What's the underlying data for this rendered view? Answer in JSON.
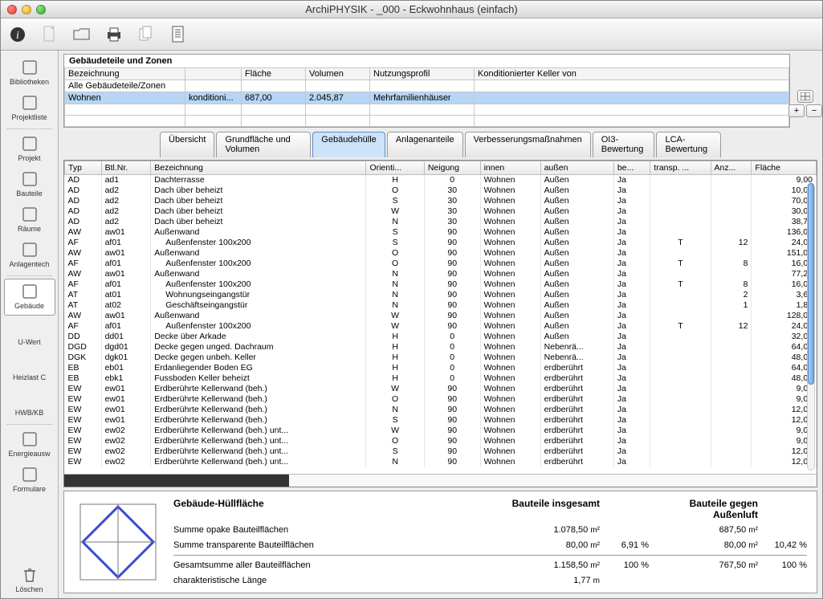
{
  "window_title": "ArchiPHYSIK - _000 - Eckwohnhaus (einfach)",
  "sidebar": [
    {
      "label": "Bibliotheken",
      "icon": "books"
    },
    {
      "label": "Projektliste",
      "icon": "list"
    },
    {
      "label": "Projekt",
      "icon": "house"
    },
    {
      "label": "Bauteile",
      "icon": "wall"
    },
    {
      "label": "Räume",
      "icon": "cube"
    },
    {
      "label": "Anlagentech",
      "icon": "gear"
    },
    {
      "label": "Gebäude",
      "icon": "building",
      "selected": true
    },
    {
      "label": "U-Wert",
      "icon": ""
    },
    {
      "label": "Heizlast C",
      "icon": ""
    },
    {
      "label": "HWB/KB",
      "icon": ""
    },
    {
      "label": "Energieausw",
      "icon": "chart"
    },
    {
      "label": "Formulare",
      "icon": "forms"
    },
    {
      "label": "Löschen",
      "icon": "trash",
      "bottom": true
    }
  ],
  "zones": {
    "title": "Gebäudeteile und Zonen",
    "headers": [
      "Bezeichnung",
      "",
      "Fläche",
      "Volumen",
      "Nutzungsprofil",
      "Konditionierter Keller von"
    ],
    "rows": [
      {
        "c": [
          "Alle Gebäudeteile/Zonen",
          "",
          "",
          "",
          "",
          ""
        ]
      },
      {
        "c": [
          "Wohnen",
          "konditioni...",
          "687,00",
          "2.045,87",
          "Mehrfamilienhäuser",
          ""
        ],
        "sel": true
      },
      {
        "c": [
          "",
          "",
          "",
          "",
          "",
          ""
        ]
      },
      {
        "c": [
          "",
          "",
          "",
          "",
          "",
          ""
        ]
      }
    ]
  },
  "tabs": [
    "Übersicht",
    "Grundfläche und Volumen",
    "Gebäudehülle",
    "Anlagenanteile",
    "Verbesserungsmaßnahmen",
    "OI3-Bewertung",
    "LCA-Bewertung"
  ],
  "active_tab": 2,
  "grid": {
    "headers": [
      "Typ",
      "Btl.Nr.",
      "Bezeichnung",
      "Orienti...",
      "Neigung",
      "innen",
      "außen",
      "be...",
      "transp. ...",
      "Anz...",
      "Fläche"
    ],
    "rows": [
      [
        "AD",
        "ad1",
        "Dachterrasse",
        "H",
        "0",
        "Wohnen",
        "Außen",
        "Ja",
        "",
        "",
        "9,00"
      ],
      [
        "AD",
        "ad2",
        "Dach über beheizt",
        "O",
        "30",
        "Wohnen",
        "Außen",
        "Ja",
        "",
        "",
        "10,00"
      ],
      [
        "AD",
        "ad2",
        "Dach über beheizt",
        "S",
        "30",
        "Wohnen",
        "Außen",
        "Ja",
        "",
        "",
        "70,00"
      ],
      [
        "AD",
        "ad2",
        "Dach über beheizt",
        "W",
        "30",
        "Wohnen",
        "Außen",
        "Ja",
        "",
        "",
        "30,00"
      ],
      [
        "AD",
        "ad2",
        "Dach über beheizt",
        "N",
        "30",
        "Wohnen",
        "Außen",
        "Ja",
        "",
        "",
        "38,75"
      ],
      [
        "AW",
        "aw01",
        "Außenwand",
        "S",
        "90",
        "Wohnen",
        "Außen",
        "Ja",
        "",
        "",
        "136,00"
      ],
      [
        "AF",
        "af01",
        "   Außenfenster 100x200",
        "S",
        "90",
        "Wohnen",
        "Außen",
        "Ja",
        "T",
        "12",
        "24,00"
      ],
      [
        "AW",
        "aw01",
        "Außenwand",
        "O",
        "90",
        "Wohnen",
        "Außen",
        "Ja",
        "",
        "",
        "151,00"
      ],
      [
        "AF",
        "af01",
        "   Außenfenster 100x200",
        "O",
        "90",
        "Wohnen",
        "Außen",
        "Ja",
        "T",
        "8",
        "16,00"
      ],
      [
        "AW",
        "aw01",
        "Außenwand",
        "N",
        "90",
        "Wohnen",
        "Außen",
        "Ja",
        "",
        "",
        "77,29"
      ],
      [
        "AF",
        "af01",
        "   Außenfenster 100x200",
        "N",
        "90",
        "Wohnen",
        "Außen",
        "Ja",
        "T",
        "8",
        "16,00"
      ],
      [
        "AT",
        "at01",
        "   Wohnungseingangstür",
        "N",
        "90",
        "Wohnen",
        "Außen",
        "Ja",
        "",
        "2",
        "3,64"
      ],
      [
        "AT",
        "at02",
        "   Geschäftseingangstür",
        "N",
        "90",
        "Wohnen",
        "Außen",
        "Ja",
        "",
        "1",
        "1,82"
      ],
      [
        "AW",
        "aw01",
        "Außenwand",
        "W",
        "90",
        "Wohnen",
        "Außen",
        "Ja",
        "",
        "",
        "128,00"
      ],
      [
        "AF",
        "af01",
        "   Außenfenster 100x200",
        "W",
        "90",
        "Wohnen",
        "Außen",
        "Ja",
        "T",
        "12",
        "24,00"
      ],
      [
        "DD",
        "dd01",
        "Decke über Arkade",
        "H",
        "0",
        "Wohnen",
        "Außen",
        "Ja",
        "",
        "",
        "32,00"
      ],
      [
        "DGD",
        "dgd01",
        "Decke gegen unged. Dachraum",
        "H",
        "0",
        "Wohnen",
        "Nebenrä...",
        "Ja",
        "",
        "",
        "64,00"
      ],
      [
        "DGK",
        "dgk01",
        "Decke gegen unbeh. Keller",
        "H",
        "0",
        "Wohnen",
        "Nebenrä...",
        "Ja",
        "",
        "",
        "48,00"
      ],
      [
        "EB",
        "eb01",
        "Erdanliegender Boden EG",
        "H",
        "0",
        "Wohnen",
        "erdberührt",
        "Ja",
        "",
        "",
        "64,00"
      ],
      [
        "EB",
        "ebk1",
        "Fussboden Keller beheizt",
        "H",
        "0",
        "Wohnen",
        "erdberührt",
        "Ja",
        "",
        "",
        "48,00"
      ],
      [
        "EW",
        "ew01",
        "Erdberührte Kellerwand (beh.)",
        "W",
        "90",
        "Wohnen",
        "erdberührt",
        "Ja",
        "",
        "",
        "9,00"
      ],
      [
        "EW",
        "ew01",
        "Erdberührte Kellerwand (beh.)",
        "O",
        "90",
        "Wohnen",
        "erdberührt",
        "Ja",
        "",
        "",
        "9,00"
      ],
      [
        "EW",
        "ew01",
        "Erdberührte Kellerwand (beh.)",
        "N",
        "90",
        "Wohnen",
        "erdberührt",
        "Ja",
        "",
        "",
        "12,00"
      ],
      [
        "EW",
        "ew01",
        "Erdberührte Kellerwand (beh.)",
        "S",
        "90",
        "Wohnen",
        "erdberührt",
        "Ja",
        "",
        "",
        "12,00"
      ],
      [
        "EW",
        "ew02",
        "Erdberührte Kellerwand (beh.) unt...",
        "W",
        "90",
        "Wohnen",
        "erdberührt",
        "Ja",
        "",
        "",
        "9,00"
      ],
      [
        "EW",
        "ew02",
        "Erdberührte Kellerwand (beh.) unt...",
        "O",
        "90",
        "Wohnen",
        "erdberührt",
        "Ja",
        "",
        "",
        "9,00"
      ],
      [
        "EW",
        "ew02",
        "Erdberührte Kellerwand (beh.) unt...",
        "S",
        "90",
        "Wohnen",
        "erdberührt",
        "Ja",
        "",
        "",
        "12,00"
      ],
      [
        "EW",
        "ew02",
        "Erdberührte Kellerwand (beh.) unt...",
        "N",
        "90",
        "Wohnen",
        "erdberührt",
        "Ja",
        "",
        "",
        "12,00"
      ]
    ]
  },
  "summary": {
    "title": "Gebäude-Hüllfläche",
    "col2": "Bauteile insgesamt",
    "col3": "Bauteile gegen Außenluft",
    "rows": [
      {
        "label": "Summe opake Bauteilflächen",
        "v1": "1.078,50",
        "u1": "m²",
        "p1": "",
        "v2": "687,50",
        "u2": "m²",
        "p2": ""
      },
      {
        "label": "Summe transparente Bauteilflächen",
        "v1": "80,00",
        "u1": "m²",
        "p1": "6,91 %",
        "v2": "80,00",
        "u2": "m²",
        "p2": "10,42 %"
      }
    ],
    "totals": [
      {
        "label": "Gesamtsumme aller Bauteilflächen",
        "v1": "1.158,50",
        "u1": "m²",
        "p1": "100 %",
        "v2": "767,50",
        "u2": "m²",
        "p2": "100 %"
      },
      {
        "label": "charakteristische Länge",
        "v1": "1,77",
        "u1": "m",
        "p1": "",
        "v2": "",
        "u2": "",
        "p2": ""
      }
    ]
  }
}
